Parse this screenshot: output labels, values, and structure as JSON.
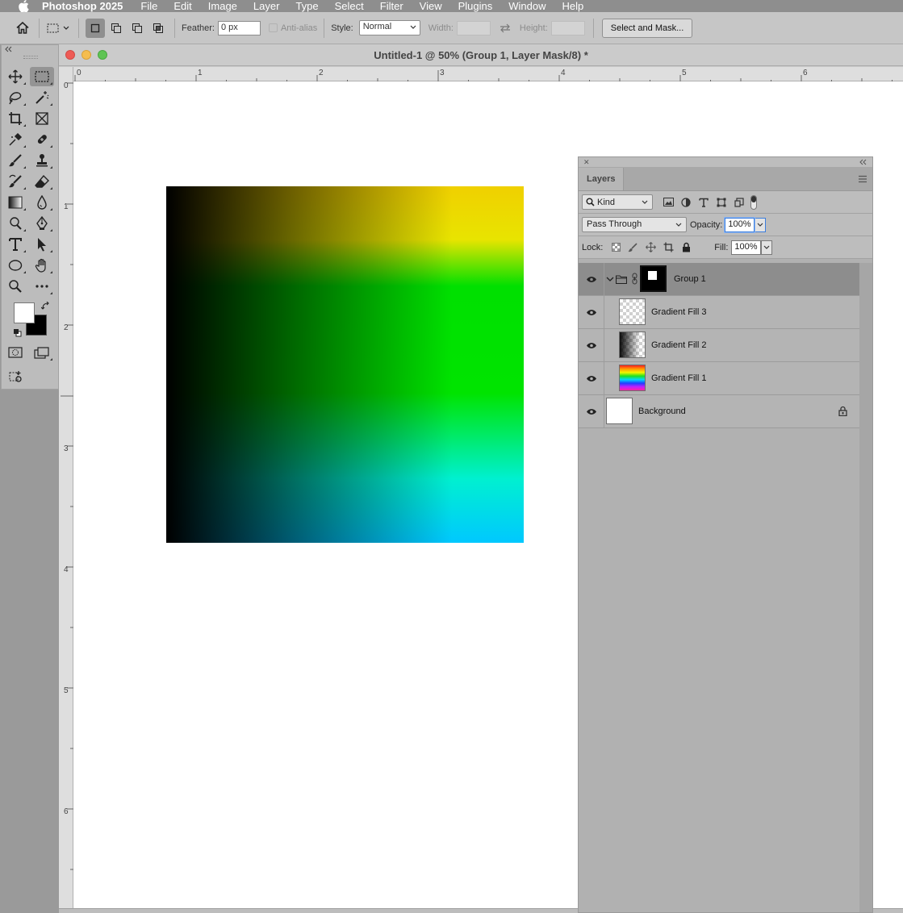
{
  "menubar": {
    "app_name": "Photoshop 2025",
    "items": [
      "File",
      "Edit",
      "Image",
      "Layer",
      "Type",
      "Select",
      "Filter",
      "View",
      "Plugins",
      "Window",
      "Help"
    ]
  },
  "options_bar": {
    "feather_label": "Feather:",
    "feather_value": "0 px",
    "antialias_label": "Anti-alias",
    "style_label": "Style:",
    "style_value": "Normal",
    "width_label": "Width:",
    "height_label": "Height:",
    "select_mask_label": "Select and Mask..."
  },
  "document": {
    "title": "Untitled-1 @ 50% (Group 1, Layer Mask/8) *",
    "ruler_h": [
      "0",
      "1",
      "2",
      "3",
      "4",
      "5",
      "6"
    ],
    "ruler_v": [
      "0",
      "1",
      "2",
      "3",
      "4",
      "5",
      "6"
    ]
  },
  "layers_panel": {
    "tab": "Layers",
    "filter_kind": "Kind",
    "blend_mode": "Pass Through",
    "opacity_label": "Opacity:",
    "opacity_value": "100%",
    "lock_label": "Lock:",
    "fill_label": "Fill:",
    "fill_value": "100%",
    "layers": [
      {
        "name": "Group 1",
        "type": "group",
        "selected": true
      },
      {
        "name": "Gradient Fill 3",
        "type": "gradient"
      },
      {
        "name": "Gradient Fill 2",
        "type": "gradient"
      },
      {
        "name": "Gradient Fill 1",
        "type": "gradient"
      },
      {
        "name": "Background",
        "type": "background",
        "locked": true
      }
    ]
  },
  "colors": {
    "foreground": "#ffffff",
    "background": "#000000",
    "selection_blue": "#3b7ddd"
  }
}
